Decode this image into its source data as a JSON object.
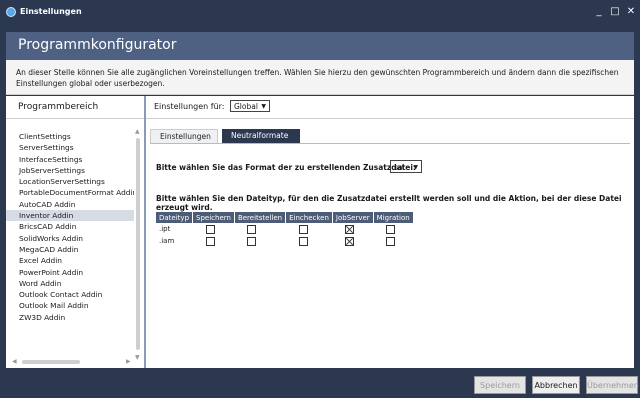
{
  "window": {
    "title": "Einstellungen",
    "controls": {
      "minimize": "_",
      "maximize": "□",
      "close": "✕"
    }
  },
  "header": {
    "title": "Programmkonfigurator"
  },
  "info": {
    "text": "An dieser Stelle können Sie alle zugänglichen Voreinstellungen treffen. Wählen Sie hierzu den gewünschten Programmbereich und ändern dann die spezifischen Einstellungen global oder userbezogen."
  },
  "sidebar": {
    "title": "Programmbereich",
    "selected": "Inventor Addin",
    "items": [
      "ClientSettings",
      "ServerSettings",
      "InterfaceSettings",
      "JobServerSettings",
      "LocationServerSettings",
      "PortableDocumentFormat Addin",
      "AutoCAD Addin",
      "Inventor Addin",
      "BricsCAD Addin",
      "SolidWorks Addin",
      "MegaCAD Addin",
      "Excel Addin",
      "PowerPoint Addin",
      "Word Addin",
      "Outlook Contact Addin",
      "Outlook Mail Addin",
      "ZW3D Addin"
    ]
  },
  "settings": {
    "scope_label": "Einstellungen für:",
    "scope_value": "Global",
    "tabs": [
      "Einstellungen",
      "Neutralformate"
    ],
    "active_tab": "Neutralformate",
    "format_question": "Bitte wählen Sie das Format der zu erstellenden Zusatzdatei:",
    "format_value": "sat",
    "type_question": "Bitte wählen Sie den Dateityp, für den die Zusatzdatei erstellt werden soll und die Aktion, bei der diese Datei erzeugt wird.",
    "table": {
      "columns": [
        "Dateityp",
        "Speichern",
        "Bereitstellen",
        "Einchecken",
        "JobServer",
        "Migration"
      ],
      "rows": [
        {
          "type": ".ipt",
          "checks": [
            false,
            false,
            false,
            true,
            false
          ]
        },
        {
          "type": ".iam",
          "checks": [
            false,
            false,
            false,
            true,
            false
          ]
        }
      ]
    }
  },
  "footer": {
    "save": "Speichern",
    "cancel": "Abbrechen",
    "apply": "Übernehmen"
  }
}
